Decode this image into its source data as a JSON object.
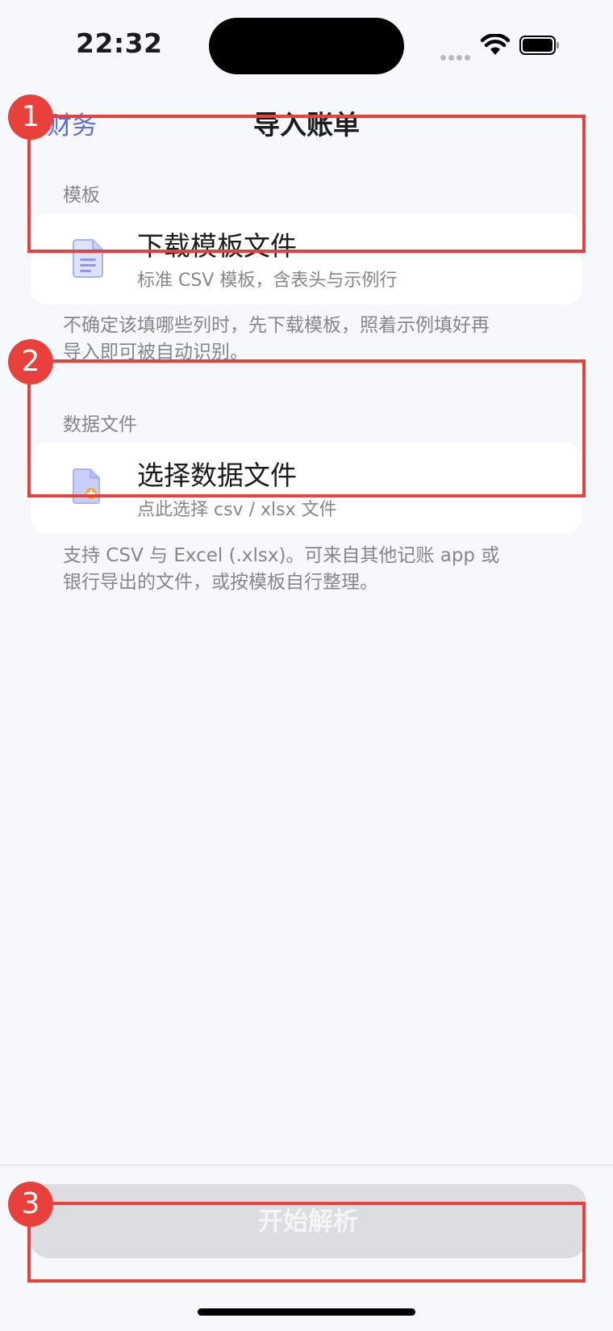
{
  "status_bar": {
    "time": "22:32"
  },
  "nav": {
    "back_label": "财务",
    "title": "导入账单"
  },
  "template_section": {
    "label": "模板",
    "card_title": "下载模板文件",
    "card_subtitle": "标准 CSV 模板，含表头与示例行",
    "footnote_line1": "不确定该填哪些列时，先下载模板，照着示例填好再",
    "footnote_line2": "导入即可被自动识别。"
  },
  "data_section": {
    "label": "数据文件",
    "card_title": "选择数据文件",
    "card_subtitle": "点此选择 csv / xlsx 文件",
    "footnote_line1": "支持 CSV 与 Excel (.xlsx)。可来自其他记账 app 或",
    "footnote_line2": "银行导出的文件，或按模板自行整理。"
  },
  "actions": {
    "parse_label": "开始解析"
  },
  "annotations": [
    {
      "label": "1"
    },
    {
      "label": "2"
    },
    {
      "label": "3"
    }
  ],
  "colors": {
    "accent": "#5b6cdb",
    "annotation": "#e8403a",
    "background": "#f7f8fc",
    "disabled_button": "#dcdde0"
  }
}
